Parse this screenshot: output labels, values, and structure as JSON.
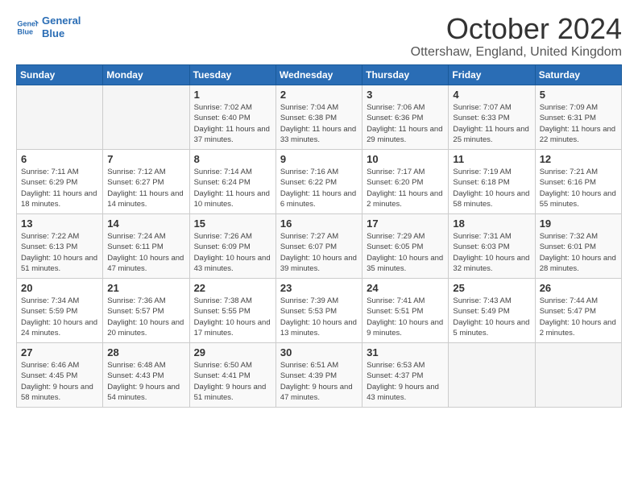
{
  "logo": {
    "line1": "General",
    "line2": "Blue"
  },
  "title": "October 2024",
  "location": "Ottershaw, England, United Kingdom",
  "days_of_week": [
    "Sunday",
    "Monday",
    "Tuesday",
    "Wednesday",
    "Thursday",
    "Friday",
    "Saturday"
  ],
  "weeks": [
    [
      {
        "day": "",
        "sunrise": "",
        "sunset": "",
        "daylight": ""
      },
      {
        "day": "",
        "sunrise": "",
        "sunset": "",
        "daylight": ""
      },
      {
        "day": "1",
        "sunrise": "Sunrise: 7:02 AM",
        "sunset": "Sunset: 6:40 PM",
        "daylight": "Daylight: 11 hours and 37 minutes."
      },
      {
        "day": "2",
        "sunrise": "Sunrise: 7:04 AM",
        "sunset": "Sunset: 6:38 PM",
        "daylight": "Daylight: 11 hours and 33 minutes."
      },
      {
        "day": "3",
        "sunrise": "Sunrise: 7:06 AM",
        "sunset": "Sunset: 6:36 PM",
        "daylight": "Daylight: 11 hours and 29 minutes."
      },
      {
        "day": "4",
        "sunrise": "Sunrise: 7:07 AM",
        "sunset": "Sunset: 6:33 PM",
        "daylight": "Daylight: 11 hours and 25 minutes."
      },
      {
        "day": "5",
        "sunrise": "Sunrise: 7:09 AM",
        "sunset": "Sunset: 6:31 PM",
        "daylight": "Daylight: 11 hours and 22 minutes."
      }
    ],
    [
      {
        "day": "6",
        "sunrise": "Sunrise: 7:11 AM",
        "sunset": "Sunset: 6:29 PM",
        "daylight": "Daylight: 11 hours and 18 minutes."
      },
      {
        "day": "7",
        "sunrise": "Sunrise: 7:12 AM",
        "sunset": "Sunset: 6:27 PM",
        "daylight": "Daylight: 11 hours and 14 minutes."
      },
      {
        "day": "8",
        "sunrise": "Sunrise: 7:14 AM",
        "sunset": "Sunset: 6:24 PM",
        "daylight": "Daylight: 11 hours and 10 minutes."
      },
      {
        "day": "9",
        "sunrise": "Sunrise: 7:16 AM",
        "sunset": "Sunset: 6:22 PM",
        "daylight": "Daylight: 11 hours and 6 minutes."
      },
      {
        "day": "10",
        "sunrise": "Sunrise: 7:17 AM",
        "sunset": "Sunset: 6:20 PM",
        "daylight": "Daylight: 11 hours and 2 minutes."
      },
      {
        "day": "11",
        "sunrise": "Sunrise: 7:19 AM",
        "sunset": "Sunset: 6:18 PM",
        "daylight": "Daylight: 10 hours and 58 minutes."
      },
      {
        "day": "12",
        "sunrise": "Sunrise: 7:21 AM",
        "sunset": "Sunset: 6:16 PM",
        "daylight": "Daylight: 10 hours and 55 minutes."
      }
    ],
    [
      {
        "day": "13",
        "sunrise": "Sunrise: 7:22 AM",
        "sunset": "Sunset: 6:13 PM",
        "daylight": "Daylight: 10 hours and 51 minutes."
      },
      {
        "day": "14",
        "sunrise": "Sunrise: 7:24 AM",
        "sunset": "Sunset: 6:11 PM",
        "daylight": "Daylight: 10 hours and 47 minutes."
      },
      {
        "day": "15",
        "sunrise": "Sunrise: 7:26 AM",
        "sunset": "Sunset: 6:09 PM",
        "daylight": "Daylight: 10 hours and 43 minutes."
      },
      {
        "day": "16",
        "sunrise": "Sunrise: 7:27 AM",
        "sunset": "Sunset: 6:07 PM",
        "daylight": "Daylight: 10 hours and 39 minutes."
      },
      {
        "day": "17",
        "sunrise": "Sunrise: 7:29 AM",
        "sunset": "Sunset: 6:05 PM",
        "daylight": "Daylight: 10 hours and 35 minutes."
      },
      {
        "day": "18",
        "sunrise": "Sunrise: 7:31 AM",
        "sunset": "Sunset: 6:03 PM",
        "daylight": "Daylight: 10 hours and 32 minutes."
      },
      {
        "day": "19",
        "sunrise": "Sunrise: 7:32 AM",
        "sunset": "Sunset: 6:01 PM",
        "daylight": "Daylight: 10 hours and 28 minutes."
      }
    ],
    [
      {
        "day": "20",
        "sunrise": "Sunrise: 7:34 AM",
        "sunset": "Sunset: 5:59 PM",
        "daylight": "Daylight: 10 hours and 24 minutes."
      },
      {
        "day": "21",
        "sunrise": "Sunrise: 7:36 AM",
        "sunset": "Sunset: 5:57 PM",
        "daylight": "Daylight: 10 hours and 20 minutes."
      },
      {
        "day": "22",
        "sunrise": "Sunrise: 7:38 AM",
        "sunset": "Sunset: 5:55 PM",
        "daylight": "Daylight: 10 hours and 17 minutes."
      },
      {
        "day": "23",
        "sunrise": "Sunrise: 7:39 AM",
        "sunset": "Sunset: 5:53 PM",
        "daylight": "Daylight: 10 hours and 13 minutes."
      },
      {
        "day": "24",
        "sunrise": "Sunrise: 7:41 AM",
        "sunset": "Sunset: 5:51 PM",
        "daylight": "Daylight: 10 hours and 9 minutes."
      },
      {
        "day": "25",
        "sunrise": "Sunrise: 7:43 AM",
        "sunset": "Sunset: 5:49 PM",
        "daylight": "Daylight: 10 hours and 5 minutes."
      },
      {
        "day": "26",
        "sunrise": "Sunrise: 7:44 AM",
        "sunset": "Sunset: 5:47 PM",
        "daylight": "Daylight: 10 hours and 2 minutes."
      }
    ],
    [
      {
        "day": "27",
        "sunrise": "Sunrise: 6:46 AM",
        "sunset": "Sunset: 4:45 PM",
        "daylight": "Daylight: 9 hours and 58 minutes."
      },
      {
        "day": "28",
        "sunrise": "Sunrise: 6:48 AM",
        "sunset": "Sunset: 4:43 PM",
        "daylight": "Daylight: 9 hours and 54 minutes."
      },
      {
        "day": "29",
        "sunrise": "Sunrise: 6:50 AM",
        "sunset": "Sunset: 4:41 PM",
        "daylight": "Daylight: 9 hours and 51 minutes."
      },
      {
        "day": "30",
        "sunrise": "Sunrise: 6:51 AM",
        "sunset": "Sunset: 4:39 PM",
        "daylight": "Daylight: 9 hours and 47 minutes."
      },
      {
        "day": "31",
        "sunrise": "Sunrise: 6:53 AM",
        "sunset": "Sunset: 4:37 PM",
        "daylight": "Daylight: 9 hours and 43 minutes."
      },
      {
        "day": "",
        "sunrise": "",
        "sunset": "",
        "daylight": ""
      },
      {
        "day": "",
        "sunrise": "",
        "sunset": "",
        "daylight": ""
      }
    ]
  ]
}
